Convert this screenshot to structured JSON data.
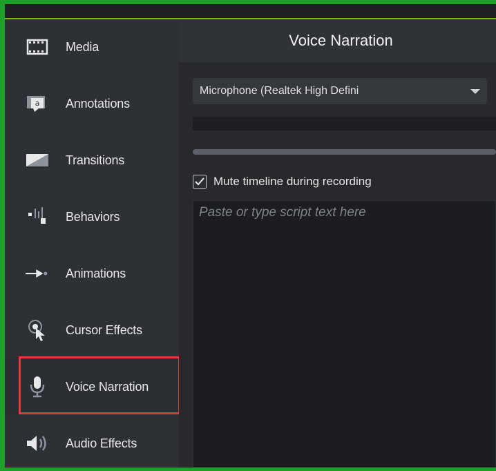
{
  "sidebar": {
    "items": [
      {
        "label": "Media",
        "icon": "film-strip-icon"
      },
      {
        "label": "Annotations",
        "icon": "callout-icon"
      },
      {
        "label": "Transitions",
        "icon": "transition-icon"
      },
      {
        "label": "Behaviors",
        "icon": "behaviors-icon"
      },
      {
        "label": "Animations",
        "icon": "arrow-animation-icon"
      },
      {
        "label": "Cursor Effects",
        "icon": "cursor-effects-icon"
      },
      {
        "label": "Voice Narration",
        "icon": "microphone-icon"
      },
      {
        "label": "Audio Effects",
        "icon": "speaker-icon"
      }
    ],
    "selected": "Voice Narration"
  },
  "panel": {
    "title": "Voice Narration",
    "device_dropdown": {
      "value": "Microphone (Realtek High Defini"
    },
    "mute_checkbox": {
      "label": "Mute timeline during recording",
      "checked": true
    },
    "script": {
      "placeholder": "Paste or type script text here"
    }
  },
  "colors": {
    "frame_green": "#1f9e2a",
    "highlight_red": "#e23b3b",
    "topbar_accent": "#7ab800"
  }
}
